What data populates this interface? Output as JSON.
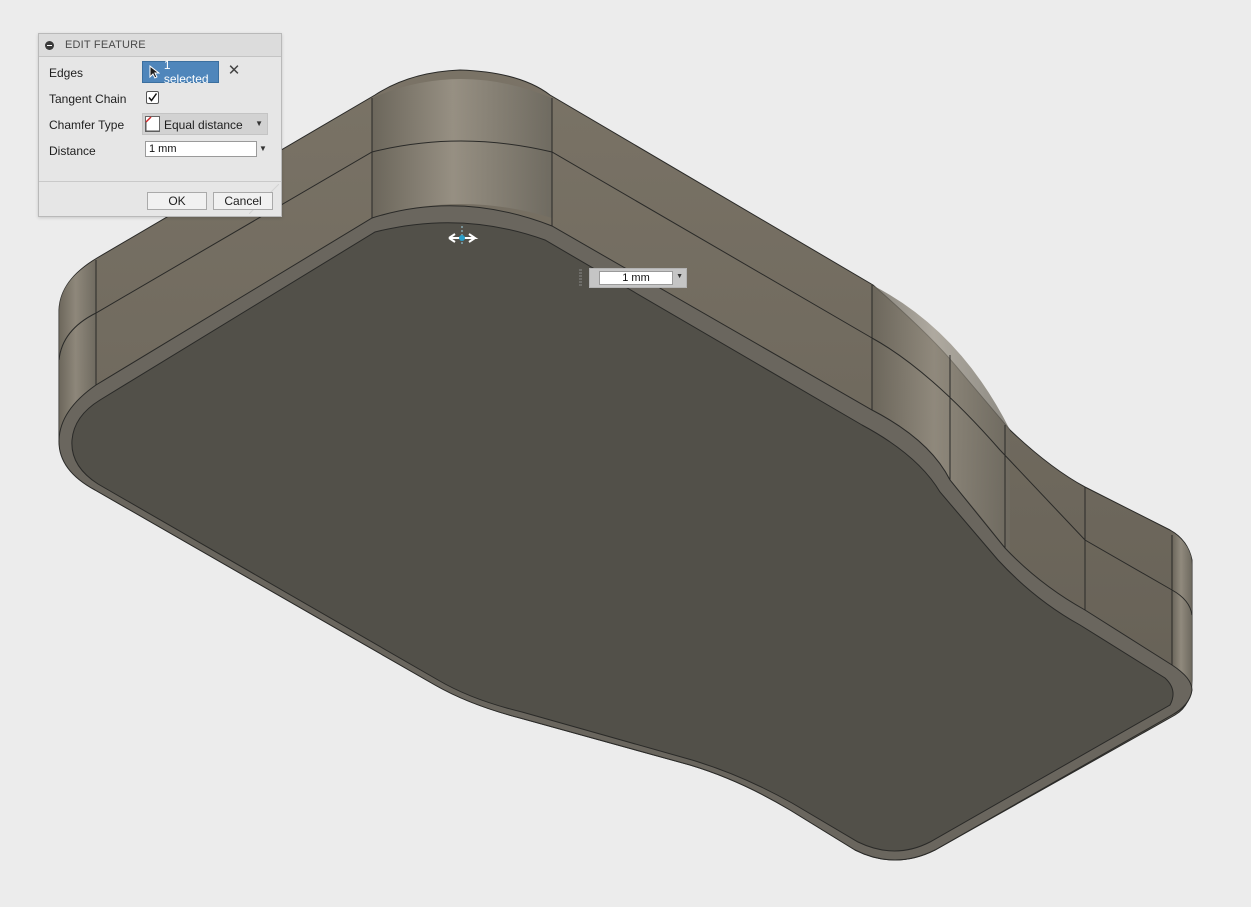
{
  "dialog": {
    "title": "EDIT FEATURE",
    "edges": {
      "label": "Edges",
      "value": "1 selected"
    },
    "tangent_chain": {
      "label": "Tangent Chain",
      "checked": true
    },
    "chamfer_type": {
      "label": "Chamfer Type",
      "value": "Equal distance"
    },
    "distance": {
      "label": "Distance",
      "value": "1 mm"
    },
    "ok_label": "OK",
    "cancel_label": "Cancel"
  },
  "viewport": {
    "distance_input": {
      "value": "1 mm"
    }
  },
  "icons": {
    "collapse": "collapse-icon",
    "select_cursor": "cursor-icon",
    "clear": "close-icon",
    "checkbox": "check-icon",
    "chamfer": "chamfer-type-icon",
    "dropdown": "chevron-down-icon",
    "manipulator": "move-arrow-icon"
  },
  "colors": {
    "selection_accent": "#4f86bb",
    "body_top": "#525049",
    "body_side": "#6e685d",
    "background": "#ececec"
  }
}
